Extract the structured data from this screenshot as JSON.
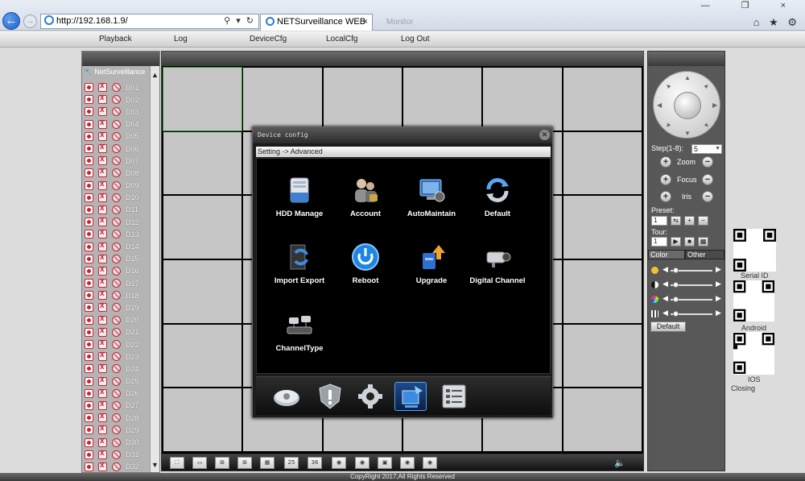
{
  "browser": {
    "url": "http://192.168.1.9/",
    "tab_title": "NETSurveillance WEB",
    "ghost_tab": "Monitor",
    "addr_tools": "⚲ ▾ ↻",
    "tab_close": "×",
    "window_controls": "— ❐ ×",
    "toolbar_icons": "⌂ ★ ⚙"
  },
  "nav": {
    "playback": "Playback",
    "log": "Log",
    "devicecfg": "DeviceCfg",
    "localcfg": "LocalCfg",
    "logout": "Log Out"
  },
  "device_tree": {
    "root": "NetSurveillance",
    "devices": [
      "D01",
      "D02",
      "D03",
      "D04",
      "D05",
      "D06",
      "D07",
      "D08",
      "D09",
      "D10",
      "D11",
      "D12",
      "D13",
      "D14",
      "D15",
      "D16",
      "D17",
      "D18",
      "D19",
      "D20",
      "D21",
      "D22",
      "D23",
      "D24",
      "D25",
      "D26",
      "D27",
      "D28",
      "D29",
      "D30",
      "D31",
      "D32"
    ]
  },
  "dialog": {
    "title": "Device config",
    "breadcrumb": "Setting -> Advanced",
    "items": [
      {
        "label": "HDD Manage",
        "icon": "hdd-icon"
      },
      {
        "label": "Account",
        "icon": "account-icon"
      },
      {
        "label": "AutoMaintain",
        "icon": "automaintain-icon"
      },
      {
        "label": "Default",
        "icon": "default-icon"
      },
      {
        "label": "Import Export",
        "icon": "import-export-icon"
      },
      {
        "label": "Reboot",
        "icon": "reboot-icon"
      },
      {
        "label": "Upgrade",
        "icon": "upgrade-icon"
      },
      {
        "label": "Digital Channel",
        "icon": "digital-channel-icon"
      },
      {
        "label": "ChannelType",
        "icon": "channel-type-icon"
      }
    ],
    "footer_tabs": [
      "record-icon",
      "alarm-icon",
      "system-gear-icon",
      "advanced-icon",
      "info-icon"
    ]
  },
  "toolbar": {
    "buttons": [
      "⛶",
      "▭",
      "⊞",
      "⊞",
      "▦",
      "25",
      "36",
      "◉",
      "◉",
      "▣",
      "◉",
      "◉"
    ],
    "volume": "🔈"
  },
  "ptz": {
    "step_label": "Step(1-8):",
    "step_value": "5",
    "zoom": "Zoom",
    "focus": "Focus",
    "iris": "Iris",
    "preset_label": "Preset:",
    "preset_value": "1",
    "tour_label": "Tour:",
    "tour_value": "1",
    "plus": "+",
    "minus": "−",
    "color_tab": "Color",
    "other_tab": "Other",
    "default_btn": "Default"
  },
  "qr": {
    "serial": "Serial ID",
    "android": "Android",
    "ios": "IOS",
    "closing": "Closing"
  },
  "footer": {
    "copyright": "CopyRight 2017,All Rights Reserved"
  }
}
